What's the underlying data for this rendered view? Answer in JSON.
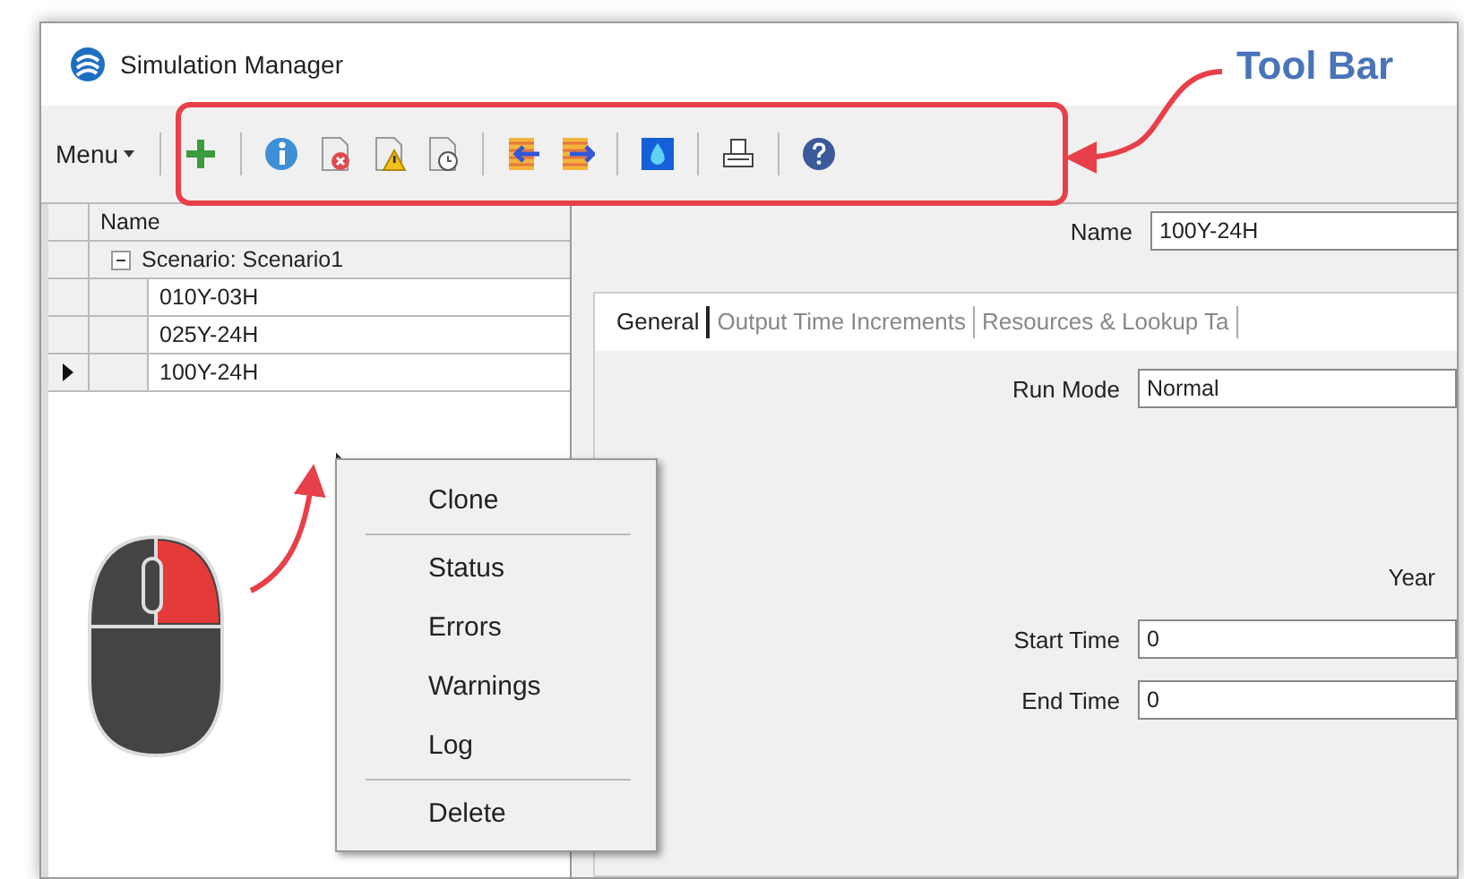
{
  "window": {
    "title": "Simulation Manager"
  },
  "menu": {
    "label": "Menu"
  },
  "annotation": {
    "label": "Tool Bar"
  },
  "tree": {
    "column": "Name",
    "items": [
      {
        "label": "Scenario: Scenario1",
        "expanded": true,
        "children": [
          {
            "label": "010Y-03H",
            "selected": false
          },
          {
            "label": "025Y-24H",
            "selected": false
          },
          {
            "label": "100Y-24H",
            "selected": true
          }
        ]
      }
    ]
  },
  "details": {
    "name_label": "Name",
    "name_value": "100Y-24H",
    "tabs": [
      {
        "label": "General",
        "selected": true
      },
      {
        "label": "Output Time Increments",
        "selected": false
      },
      {
        "label": "Resources & Lookup Ta",
        "selected": false
      }
    ],
    "fields": [
      {
        "kind": "field",
        "label": "Run Mode",
        "value": "Normal"
      },
      {
        "kind": "heading",
        "label": "Year"
      },
      {
        "kind": "field",
        "label": "Start Time",
        "value": "0"
      },
      {
        "kind": "field",
        "label": "End Time",
        "value": "0"
      }
    ]
  },
  "context_menu": {
    "items": [
      {
        "label": "Clone",
        "separator_after": true
      },
      {
        "label": "Status",
        "separator_after": false
      },
      {
        "label": "Errors",
        "separator_after": false
      },
      {
        "label": "Warnings",
        "separator_after": false
      },
      {
        "label": "Log",
        "separator_after": true
      },
      {
        "label": "Delete",
        "separator_after": false
      }
    ]
  }
}
